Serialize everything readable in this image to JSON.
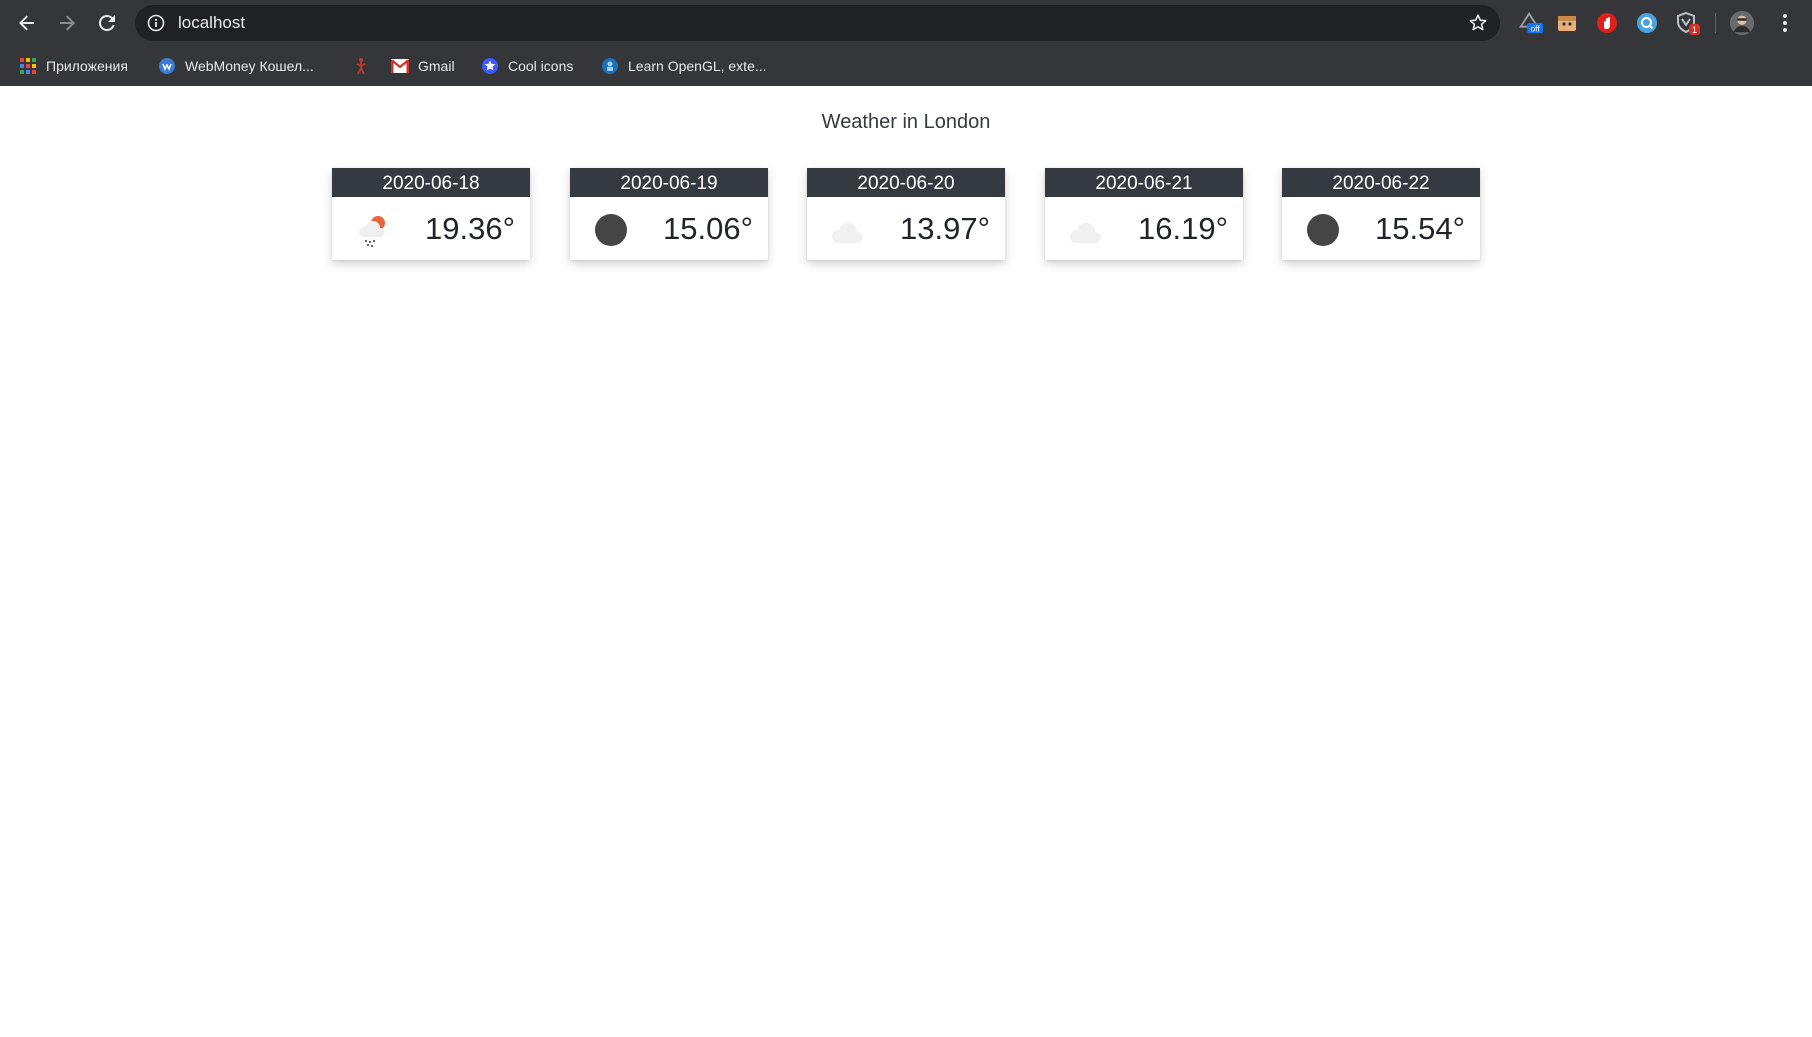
{
  "browser": {
    "url": "localhost",
    "bookmarks": [
      {
        "label": "Приложения",
        "icon": "apps-grid-icon"
      },
      {
        "label": "WebMoney Кошел...",
        "icon": "webmoney-icon"
      },
      {
        "label": "",
        "icon": "red-figure-icon"
      },
      {
        "label": "Gmail",
        "icon": "gmail-icon"
      },
      {
        "label": "Cool icons",
        "icon": "star-badge-icon"
      },
      {
        "label": "Learn OpenGL, exte...",
        "icon": "opengl-icon"
      }
    ],
    "extensions": [
      {
        "name": "extension-off-icon",
        "badge": "off"
      },
      {
        "name": "extension-box-icon",
        "badge": ""
      },
      {
        "name": "extension-hand-icon",
        "badge": ""
      },
      {
        "name": "extension-search-icon",
        "badge": ""
      },
      {
        "name": "extension-shield-icon",
        "badge": "1"
      }
    ]
  },
  "page": {
    "title": "Weather in London"
  },
  "forecast": [
    {
      "date": "2020-06-18",
      "temp": "19.36°",
      "icon": "snow-sun-icon"
    },
    {
      "date": "2020-06-19",
      "temp": "15.06°",
      "icon": "dark-circle-icon"
    },
    {
      "date": "2020-06-20",
      "temp": "13.97°",
      "icon": "cloud-icon"
    },
    {
      "date": "2020-06-21",
      "temp": "16.19°",
      "icon": "cloud-icon"
    },
    {
      "date": "2020-06-22",
      "temp": "15.54°",
      "icon": "dark-circle-icon"
    }
  ],
  "colors": {
    "browser_frame": "#35363a",
    "omnibox": "#202124",
    "card_header": "#343a40",
    "sun_orange": "#e8643c",
    "dark_circle": "#454545",
    "cloud_gray": "#f0f0f0"
  }
}
